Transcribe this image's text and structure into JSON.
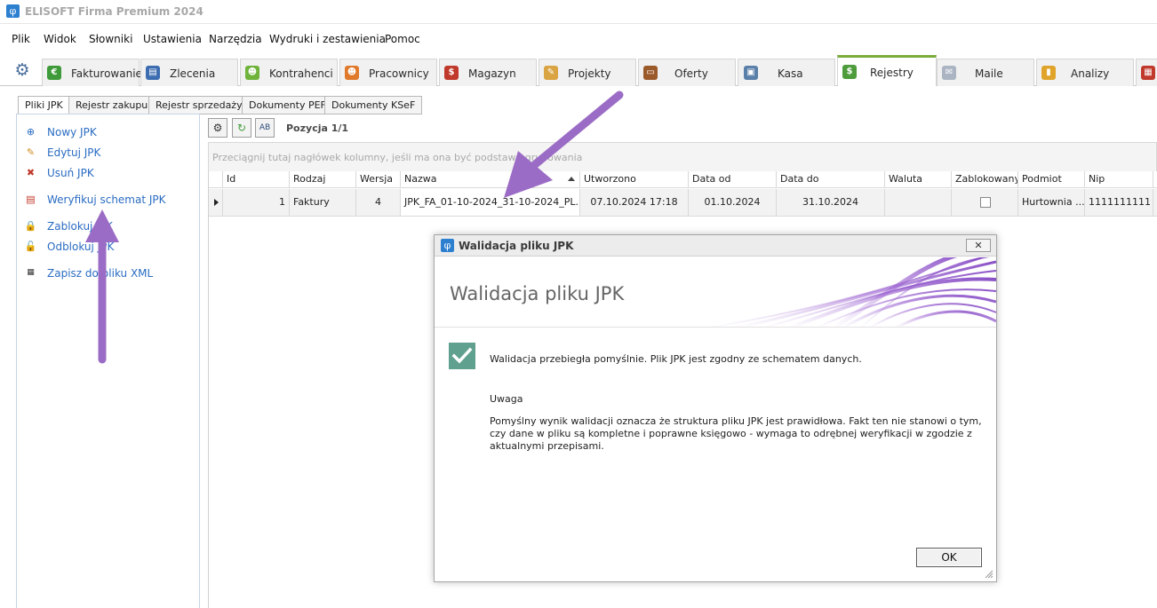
{
  "app": {
    "title": "ELISOFT Firma Premium 2024",
    "logo_glyph": "φ"
  },
  "menu": [
    "Plik",
    "Widok",
    "Słowniki",
    "Ustawienia",
    "Narzędzia",
    "Wydruki i zestawienia",
    "Pomoc"
  ],
  "module_tabs": [
    {
      "label": "Fakturowanie",
      "icon": "euro-icon"
    },
    {
      "label": "Zlecenia",
      "icon": "stack-icon"
    },
    {
      "label": "Kontrahenci",
      "icon": "people-icon"
    },
    {
      "label": "Pracownicy",
      "icon": "workers-icon"
    },
    {
      "label": "Magazyn",
      "icon": "bag-icon"
    },
    {
      "label": "Projekty",
      "icon": "pen-icon"
    },
    {
      "label": "Oferty",
      "icon": "briefcase-icon"
    },
    {
      "label": "Kasa",
      "icon": "register-icon"
    },
    {
      "label": "Rejestry",
      "icon": "money-icon",
      "active": true
    },
    {
      "label": "Maile",
      "icon": "mail-icon"
    },
    {
      "label": "Analizy",
      "icon": "chart-icon"
    }
  ],
  "sub_tabs": [
    "Pliki JPK",
    "Rejestr zakupu",
    "Rejestr sprzedaży",
    "Dokumenty PEF",
    "Dokumenty KSeF"
  ],
  "actions": {
    "new": "Nowy JPK",
    "edit": "Edytuj JPK",
    "delete": "Usuń JPK",
    "verify": "Weryfikuj schemat JPK",
    "lock": "Zablokuj JPK",
    "unlock": "Odblokuj JPK",
    "save_xml": "Zapisz do pliku XML"
  },
  "grid": {
    "position": "Pozycja 1/1",
    "group_hint": "Przeciągnij tutaj nagłówek kolumny, jeśli ma ona być podstawą grupowania",
    "columns": {
      "id": "Id",
      "kind": "Rodzaj",
      "version": "Wersja",
      "name": "Nazwa",
      "created": "Utworzono",
      "date_from": "Data od",
      "date_to": "Data do",
      "currency": "Waluta",
      "locked": "Zablokowany",
      "entity": "Podmiot",
      "nip": "Nip"
    },
    "row": {
      "id": "1",
      "kind": "Faktury",
      "version": "4",
      "name": "JPK_FA_01-10-2024_31-10-2024_PL...",
      "created": "07.10.2024 17:18",
      "date_from": "01.10.2024",
      "date_to": "31.10.2024",
      "currency": "",
      "locked": false,
      "entity": "Hurtownia ...",
      "nip": "1111111111"
    }
  },
  "dialog": {
    "title": "Walidacja pliku JPK",
    "heading": "Walidacja pliku JPK",
    "success": "Walidacja przebiegła pomyślnie. Plik JPK jest zgodny ze schematem danych.",
    "note_title": "Uwaga",
    "note_text": "Pomyślny wynik walidacji oznacza że struktura pliku JPK jest prawidłowa. Fakt ten nie stanowi o tym, czy dane w pliku są kompletne i poprawne księgowo - wymaga to odrębnej weryfikacji w zgodzie z aktualnymi przepisami.",
    "ok": "OK",
    "close_glyph": "✕"
  },
  "colors": {
    "accent_tab": "#79ad3a",
    "link": "#2a6cc2",
    "arrow": "#9b6cc5",
    "check": "#5fa08f"
  }
}
